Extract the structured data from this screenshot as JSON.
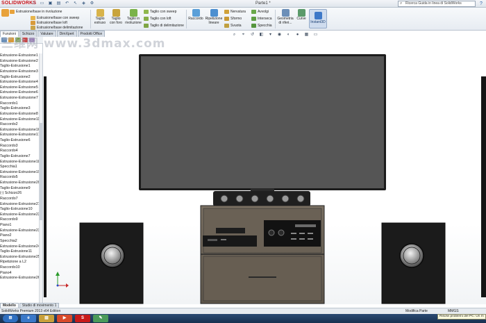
{
  "app": {
    "logo": "SOLIDWORKS",
    "document_title": "Parte1 *",
    "help_search_placeholder": "Ricerca Guida in linea di SolidWorks",
    "help_button": "?"
  },
  "quick_access": [
    "new",
    "open",
    "save",
    "print",
    "undo",
    "select",
    "rebuild",
    "options"
  ],
  "ribbon": {
    "features_big": [
      {
        "label": "Estrusione/base in rivoluzione",
        "icon": "extrude-icon"
      },
      {
        "label": "Taglio estruso",
        "icon": "cut-extrude-icon"
      },
      {
        "label": "Taglio con foro",
        "icon": "hole-wizard-icon"
      },
      {
        "label": "Taglio in rivoluzione",
        "icon": "revolved-cut-icon"
      }
    ],
    "features_small_left": [
      {
        "label": "Estrusione/base con sweep",
        "icon": "sweep-icon"
      },
      {
        "label": "Estrusione/base loft",
        "icon": "loft-icon"
      },
      {
        "label": "Estrusione/base delimitazione",
        "icon": "boundary-icon"
      }
    ],
    "cut_small": [
      {
        "label": "Taglio con sweep",
        "icon": "swept-cut-icon"
      },
      {
        "label": "Taglio con loft",
        "icon": "lofted-cut-icon"
      },
      {
        "label": "Taglio di delimitazione",
        "icon": "boundary-cut-icon"
      }
    ],
    "modify_big": [
      {
        "label": "Raccordo",
        "icon": "fillet-icon"
      },
      {
        "label": "Ripetizione lineare",
        "icon": "linear-pattern-icon"
      }
    ],
    "modify_small": [
      {
        "label": "Nervatura",
        "icon": "rib-icon"
      },
      {
        "label": "Sformo",
        "icon": "draft-icon"
      },
      {
        "label": "Svuota",
        "icon": "shell-icon"
      }
    ],
    "wrap_small": [
      {
        "label": "Avvolgi",
        "icon": "wrap-icon"
      },
      {
        "label": "Interseca",
        "icon": "intersect-icon"
      },
      {
        "label": "Specchia",
        "icon": "mirror-icon"
      }
    ],
    "ref_big": [
      {
        "label": "Geometria di riferi...",
        "icon": "reference-geometry-icon"
      },
      {
        "label": "Curve",
        "icon": "curves-icon"
      }
    ],
    "instant3d": "Instant3D"
  },
  "tabs": [
    "Funzioni",
    "Schizzo",
    "Valutare",
    "DimXpert",
    "Prodotti Office"
  ],
  "active_tab": 0,
  "hud_icons": [
    "zoom-to-fit-icon",
    "zoom-area-icon",
    "previous-view-icon",
    "section-view-icon",
    "view-orientation-icon",
    "display-style-icon",
    "hide-show-icon",
    "appearance-icon",
    "scene-icon",
    "view-settings-icon"
  ],
  "tree": {
    "tools": [
      "feature-manager-icon",
      "property-manager-icon",
      "configuration-manager-icon",
      "dimxpert-icon",
      "display-manager-icon"
    ],
    "items": [
      "Estrusione-Estrusione1",
      "Estrusione-Estrusione2",
      "Taglio-Estrusione1",
      "Estrusione-Estrusione3",
      "Taglio-Estrusione2",
      "Estrusione-Estrusione4",
      "Estrusione-Estrusione5",
      "Estrusione-Estrusione6",
      "Estrusione-Estrusione7",
      "Raccordo1",
      "Taglio-Estrusione3",
      "Estrusione-Estrusione8",
      "Estrusione-Estrusione11",
      "Raccordo2",
      "Estrusione-Estrusione16",
      "Estrusione-Estrusione17",
      "Taglio-Estrusione6",
      "Raccordo3",
      "Raccordo4",
      "Taglio-Estrusione7",
      "Estrusione-Estrusione18",
      "Specchia1",
      "Estrusione-Estrusione19",
      "Raccordo5",
      "Estrusione-Estrusione20",
      "Taglio-Estrusione9",
      "(-) Schizzo26",
      "Raccordo7",
      "Estrusione-Estrusione21",
      "Taglio-Estrusione10",
      "Estrusione-Estrusione22",
      "Raccordo9",
      "Piano1",
      "Estrusione-Estrusione23",
      "Piano2",
      "Specchia2",
      "Estrusione-Estrusione24",
      "Taglio-Estrusione11",
      "Estrusione-Estrusione25",
      "Ripetizione a L2",
      "Raccordo10",
      "Piano4",
      "Estrusione-Estrusione26"
    ]
  },
  "bottom_tabs": [
    "Modello",
    "Studio di movimento 1"
  ],
  "active_bottom_tab": 0,
  "status": {
    "edition": "SolidWorks Premium 2013 x64 Edition",
    "mode": "Modifica Parte",
    "units": "MMGS"
  },
  "taskbar": {
    "apps": [
      "start-orb-icon",
      "ie-icon",
      "explorer-icon",
      "media-player-icon",
      "solidworks-icon",
      "paint-icon"
    ],
    "tooltip": "Risolvi problemi del PC: Un m"
  },
  "watermark": "三维网 www.3dmax.com",
  "colors": {
    "tv_screen": "#555555",
    "cabinet": "#6f6558",
    "speaker_box": "#1b1b1b",
    "logo_red": "#c8171e",
    "instant3d_blue": "#3d78c8"
  }
}
